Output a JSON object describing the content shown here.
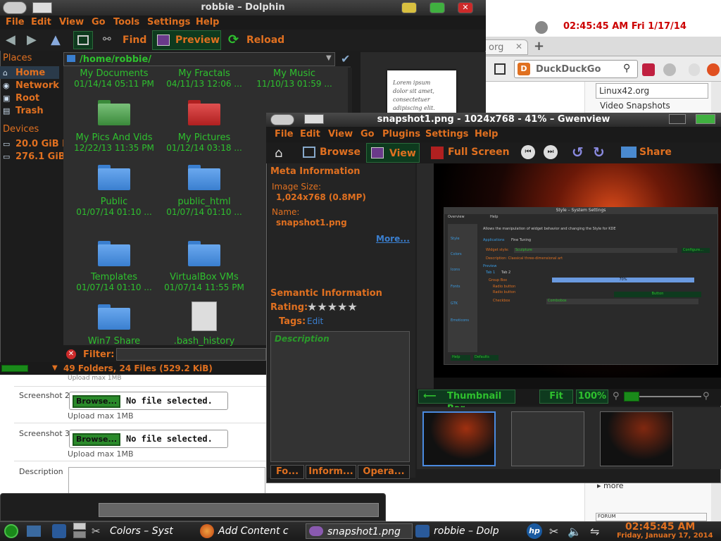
{
  "firefox": {
    "clock": "02:45:45 AM Fri  1/17/14",
    "tab_label": "org",
    "tab_close": "✕",
    "newtab": "+",
    "search_engine_letter": "D",
    "search_placeholder": "DuckDuckGo",
    "sidebar_field": "Linux42.org",
    "video_snapshots": "Video Snapshots",
    "more": "more",
    "forum": "FORUM"
  },
  "webform": {
    "upload_max_top": "Upload max 1MB",
    "screenshot2": "Screenshot 2",
    "screenshot3": "Screenshot 3",
    "browse": "Browse...",
    "no_file": "No file selected.",
    "upload_max": "Upload max 1MB",
    "description": "Description"
  },
  "dolphin": {
    "title": "robbie – Dolphin",
    "menu": [
      "File",
      "Edit",
      "View",
      "Go",
      "Tools",
      "Settings",
      "Help"
    ],
    "toolbar": {
      "find": "Find",
      "preview": "Preview",
      "reload": "Reload"
    },
    "places_title": "Places",
    "places": [
      "Home",
      "Network",
      "Root",
      "Trash"
    ],
    "devices_title": "Devices",
    "devices": [
      "20.0 GiB I",
      "276.1 GiB"
    ],
    "path": "/home/robbie/",
    "items": [
      {
        "name": "My Documents",
        "date": "01/14/14 05:11 PM"
      },
      {
        "name": "My Fractals",
        "date": "04/11/13 12:06 ..."
      },
      {
        "name": "My Music",
        "date": "11/10/13 01:59 ..."
      },
      {
        "name": "My Pics And Vids",
        "date": "12/22/13 11:35 PM"
      },
      {
        "name": "My Pictures",
        "date": "01/12/14 03:18 ..."
      },
      {
        "name": "Public",
        "date": "01/07/14 01:10 ..."
      },
      {
        "name": "public_html",
        "date": "01/07/14 01:10 ..."
      },
      {
        "name": "Templates",
        "date": "01/07/14 01:10 ..."
      },
      {
        "name": "VirtualBox VMs",
        "date": "01/07/14 11:55 PM"
      },
      {
        "name": "Win7 Share",
        "date": ""
      },
      {
        "name": ".bash_history",
        "date": ""
      }
    ],
    "filter_label": "Filter:",
    "status": "49 Folders, 24 Files (529.2 KiB)",
    "preview_doc_text": [
      "Lorem ipsum",
      "dolor sit amet,",
      "consectetuer",
      "adipiscing elit."
    ]
  },
  "gwenview": {
    "title": "snapshot1.png - 1024x768 - 41% – Gwenview",
    "menu": [
      "File",
      "Edit",
      "View",
      "Go",
      "Plugins",
      "Settings",
      "Help"
    ],
    "toolbar": {
      "browse": "Browse",
      "view": "View",
      "fullscreen": "Full Screen",
      "share": "Share"
    },
    "meta_title": "Meta Information",
    "image_size_label": "Image Size:",
    "image_size_value": "1,024x768 (0.8MP)",
    "name_label": "Name:",
    "name_value": "snapshot1.png",
    "more": "More...",
    "semantic_title": "Semantic Information",
    "rating_label": "Rating:",
    "rating": 0,
    "tags_label": "Tags:",
    "tags_edit": "Edit",
    "description_label": "Description",
    "tabs": [
      "Fo...",
      "Inform...",
      "Opera..."
    ],
    "thumbnail_bar": "Thumbnail Bar",
    "fit": "Fit",
    "zoom": "100%",
    "inner_title": "Style – System Settings",
    "inner_overview": "Overview",
    "inner_help": "Help",
    "inner_desc": "Allows the manipulation of widget behavior and changing the Style for KDE",
    "inner_tabs": [
      "Applications",
      "Fine Tuning"
    ],
    "inner_widget_style_label": "Widget style:",
    "inner_widget_style": "Sculpture",
    "inner_configure": "Configure...",
    "inner_widget_desc": "Description: Classical three-dimensional art",
    "inner_preview": "Preview",
    "inner_preview_tabs": [
      "Tab 1",
      "Tab 2"
    ],
    "inner_groupbox": "Group Box",
    "inner_progress": "70%",
    "inner_radio1": "Radio button",
    "inner_radio2": "Radio button",
    "inner_button": "Button",
    "inner_checkbox": "Checkbox",
    "inner_combobox": "Combobox",
    "inner_side": [
      "Style",
      "Colors",
      "Icons",
      "Fonts",
      "GTK",
      "Emoticons"
    ],
    "inner_footer": [
      "Help",
      "Defaults"
    ]
  },
  "taskbar": {
    "tasks": [
      "Colors – Syst",
      "Add Content c",
      "snapshot1.png",
      "robbie – Dolp"
    ],
    "time": "02:45:45 AM",
    "date": "Friday, January 17, 2014"
  },
  "colors": {
    "accent": "#e07020",
    "green": "#2ec02e",
    "folder": "#3a7fd0"
  }
}
